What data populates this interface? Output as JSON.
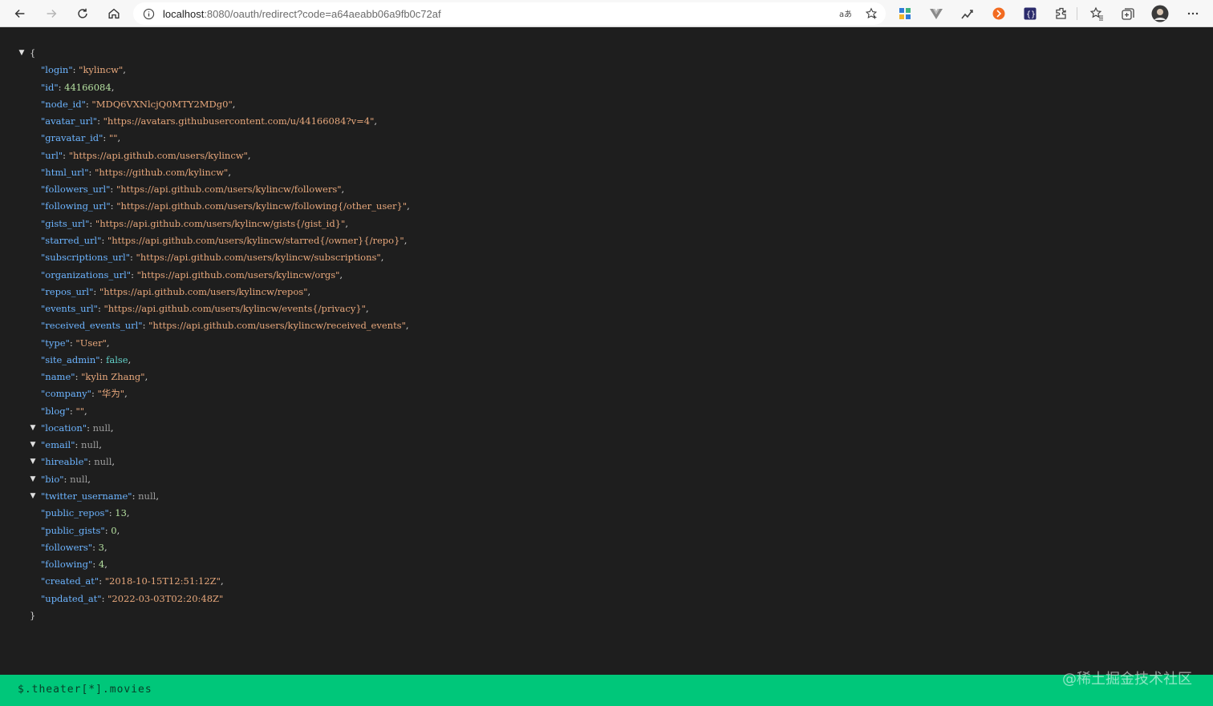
{
  "browser": {
    "url_host": "localhost",
    "url_path": ":8080/oauth/redirect?code=a64aeabb06a9fb0c72af"
  },
  "json_lines": [
    {
      "indent": 0,
      "toggle": true,
      "open": "{"
    },
    {
      "indent": 1,
      "key": "\"login\"",
      "val": "\"kylincw\"",
      "type": "s",
      "comma": true
    },
    {
      "indent": 1,
      "key": "\"id\"",
      "val": "44166084",
      "type": "n",
      "comma": true
    },
    {
      "indent": 1,
      "key": "\"node_id\"",
      "val": "\"MDQ6VXNlcjQ0MTY2MDg0\"",
      "type": "s",
      "comma": true
    },
    {
      "indent": 1,
      "key": "\"avatar_url\"",
      "val": "\"https://avatars.githubusercontent.com/u/44166084?v=4\"",
      "type": "s",
      "comma": true
    },
    {
      "indent": 1,
      "key": "\"gravatar_id\"",
      "val": "\"\"",
      "type": "s",
      "comma": true
    },
    {
      "indent": 1,
      "key": "\"url\"",
      "val": "\"https://api.github.com/users/kylincw\"",
      "type": "s",
      "comma": true
    },
    {
      "indent": 1,
      "key": "\"html_url\"",
      "val": "\"https://github.com/kylincw\"",
      "type": "s",
      "comma": true
    },
    {
      "indent": 1,
      "key": "\"followers_url\"",
      "val": "\"https://api.github.com/users/kylincw/followers\"",
      "type": "s",
      "comma": true
    },
    {
      "indent": 1,
      "key": "\"following_url\"",
      "val": "\"https://api.github.com/users/kylincw/following{/other_user}\"",
      "type": "s",
      "comma": true
    },
    {
      "indent": 1,
      "key": "\"gists_url\"",
      "val": "\"https://api.github.com/users/kylincw/gists{/gist_id}\"",
      "type": "s",
      "comma": true
    },
    {
      "indent": 1,
      "key": "\"starred_url\"",
      "val": "\"https://api.github.com/users/kylincw/starred{/owner}{/repo}\"",
      "type": "s",
      "comma": true
    },
    {
      "indent": 1,
      "key": "\"subscriptions_url\"",
      "val": "\"https://api.github.com/users/kylincw/subscriptions\"",
      "type": "s",
      "comma": true
    },
    {
      "indent": 1,
      "key": "\"organizations_url\"",
      "val": "\"https://api.github.com/users/kylincw/orgs\"",
      "type": "s",
      "comma": true
    },
    {
      "indent": 1,
      "key": "\"repos_url\"",
      "val": "\"https://api.github.com/users/kylincw/repos\"",
      "type": "s",
      "comma": true
    },
    {
      "indent": 1,
      "key": "\"events_url\"",
      "val": "\"https://api.github.com/users/kylincw/events{/privacy}\"",
      "type": "s",
      "comma": true
    },
    {
      "indent": 1,
      "key": "\"received_events_url\"",
      "val": "\"https://api.github.com/users/kylincw/received_events\"",
      "type": "s",
      "comma": true
    },
    {
      "indent": 1,
      "key": "\"type\"",
      "val": "\"User\"",
      "type": "s",
      "comma": true
    },
    {
      "indent": 1,
      "key": "\"site_admin\"",
      "val": "false",
      "type": "bool",
      "comma": true
    },
    {
      "indent": 1,
      "key": "\"name\"",
      "val": "\"kylin Zhang\"",
      "type": "s",
      "comma": true
    },
    {
      "indent": 1,
      "key": "\"company\"",
      "val": "\"华为\"",
      "type": "s",
      "comma": true
    },
    {
      "indent": 1,
      "key": "\"blog\"",
      "val": "\"\"",
      "type": "s",
      "comma": true
    },
    {
      "indent": 1,
      "toggle": true,
      "key": "\"location\"",
      "val": "null",
      "type": "nul",
      "comma": true
    },
    {
      "indent": 1,
      "toggle": true,
      "key": "\"email\"",
      "val": "null",
      "type": "nul",
      "comma": true
    },
    {
      "indent": 1,
      "toggle": true,
      "key": "\"hireable\"",
      "val": "null",
      "type": "nul",
      "comma": true
    },
    {
      "indent": 1,
      "toggle": true,
      "key": "\"bio\"",
      "val": "null",
      "type": "nul",
      "comma": true
    },
    {
      "indent": 1,
      "toggle": true,
      "key": "\"twitter_username\"",
      "val": "null",
      "type": "nul",
      "comma": true
    },
    {
      "indent": 1,
      "key": "\"public_repos\"",
      "val": "13",
      "type": "n",
      "comma": true
    },
    {
      "indent": 1,
      "key": "\"public_gists\"",
      "val": "0",
      "type": "n",
      "comma": true
    },
    {
      "indent": 1,
      "key": "\"followers\"",
      "val": "3",
      "type": "n",
      "comma": true
    },
    {
      "indent": 1,
      "key": "\"following\"",
      "val": "4",
      "type": "n",
      "comma": true
    },
    {
      "indent": 1,
      "key": "\"created_at\"",
      "val": "\"2018-10-15T12:51:12Z\"",
      "type": "s",
      "comma": true
    },
    {
      "indent": 1,
      "key": "\"updated_at\"",
      "val": "\"2022-03-03T02:20:48Z\"",
      "type": "s",
      "comma": false
    },
    {
      "indent": 0,
      "close": "}"
    }
  ],
  "bottom_bar": {
    "query": "$.theater[*].movies",
    "watermark": "@稀土掘金技术社区"
  }
}
